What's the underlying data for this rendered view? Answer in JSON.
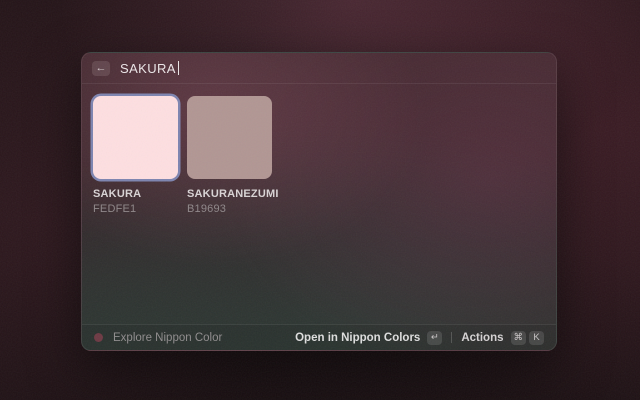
{
  "window": {
    "search": {
      "value": "SAKURA",
      "back_icon": "←"
    },
    "grid": {
      "items": [
        {
          "name": "SAKURA",
          "hex": "FEDFE1",
          "color": "#FEDFE1",
          "selected": true
        },
        {
          "name": "SAKURANEZUMI",
          "hex": "B19693",
          "color": "#B19693",
          "selected": false
        }
      ]
    },
    "footer": {
      "app_label": "Explore Nippon Color",
      "app_icon_color": "#6d3943",
      "primary_action_label": "Open in Nippon Colors",
      "primary_action_key": "↵",
      "actions_label": "Actions",
      "actions_keys": [
        "⌘",
        "K"
      ]
    }
  },
  "colors": {
    "selection_ring": "#7d84b0"
  }
}
